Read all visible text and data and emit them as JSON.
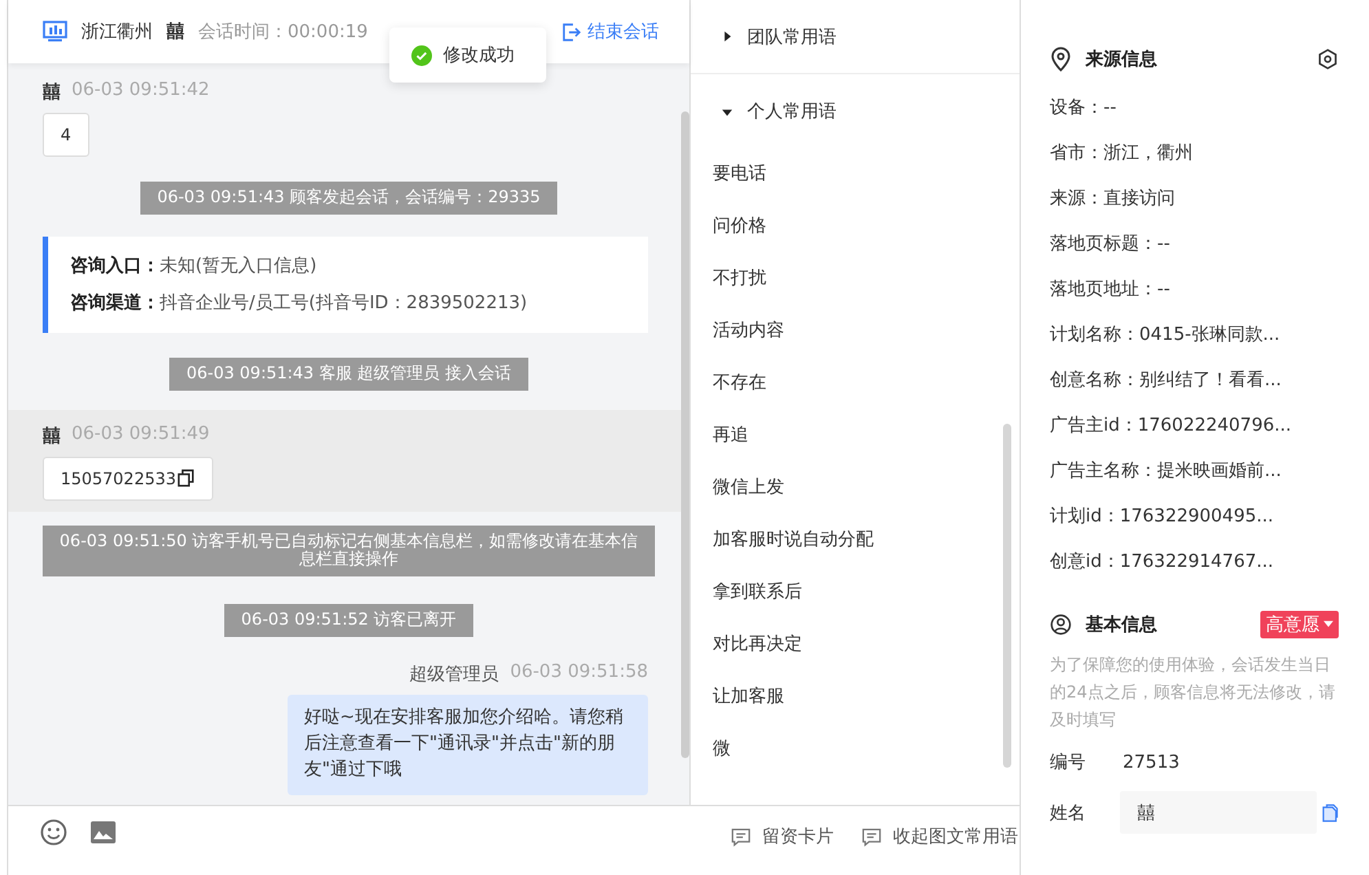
{
  "header": {
    "location": "浙江衢州",
    "visitor": "囍",
    "duration": "会话时间：00:00:19",
    "end_button": "结束会话"
  },
  "toast": {
    "text": "修改成功"
  },
  "messages": [
    {
      "kind": "visitor",
      "name": "囍",
      "time": "06-03 09:51:42",
      "text": "4",
      "copy": false,
      "highlighted": false
    },
    {
      "kind": "system",
      "text": "06-03 09:51:43 顾客发起会话，会话编号：29335"
    },
    {
      "kind": "info",
      "rows": [
        {
          "label": "咨询入口：",
          "value": "未知(暂无入口信息)"
        },
        {
          "label": "咨询渠道：",
          "value": "抖音企业号/员工号(抖音号ID：2839502213)"
        }
      ]
    },
    {
      "kind": "system",
      "text": "06-03 09:51:43 客服 超级管理员 接入会话"
    },
    {
      "kind": "visitor",
      "name": "囍",
      "time": "06-03 09:51:49",
      "text": "15057022533",
      "copy": true,
      "highlighted": true
    },
    {
      "kind": "system",
      "text": "06-03 09:51:50 访客手机号已自动标记右侧基本信息栏，如需修改请在基本信息栏直接操作"
    },
    {
      "kind": "system",
      "text": "06-03 09:51:52 访客已离开"
    },
    {
      "kind": "agent",
      "name": "超级管理员",
      "time": "06-03 09:51:58",
      "text": "好哒~现在安排客服加您介绍哈。请您稍后注意查看一下\"通讯录\"并点击\"新的朋友\"通过下哦"
    }
  ],
  "footer_buttons": [
    "留资卡片",
    "收起图文常用语"
  ],
  "phrases": {
    "groups": [
      {
        "title": "团队常用语",
        "expanded": false
      },
      {
        "title": "个人常用语",
        "expanded": true
      }
    ],
    "items": [
      "要电话",
      "问价格",
      "不打扰",
      "活动内容",
      "不存在",
      "再追",
      "微信上发",
      "加客服时说自动分配",
      "拿到联系后",
      "对比再决定",
      "让加客服",
      "微"
    ]
  },
  "source_info": {
    "title": "来源信息",
    "fields": [
      "设备：--",
      "省市：浙江，衢州",
      "来源：直接访问",
      "落地页标题：--",
      "落地页地址：--",
      "计划名称：0415-张琳同款...",
      "创意名称：别纠结了！看看...",
      "广告主id：176022240796...",
      "广告主名称：提米映画婚前...",
      "计划id：176322900495...",
      "创意id：176322914767..."
    ]
  },
  "basic_info": {
    "title": "基本信息",
    "intent": "高意愿",
    "note": "为了保障您的使用体验，会话发生当日的24点之后，顾客信息将无法修改，请及时填写",
    "number_label": "编号",
    "number": "27513",
    "name_label": "姓名",
    "name": "囍"
  }
}
